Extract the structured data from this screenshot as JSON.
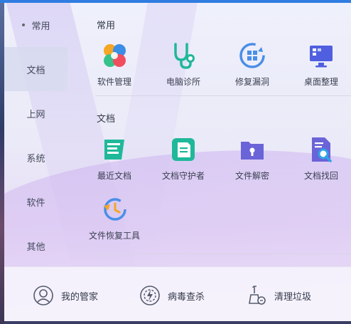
{
  "sidebar": {
    "items": [
      {
        "label": "常用",
        "active": false,
        "dot": true
      },
      {
        "label": "文档",
        "active": true,
        "dot": false
      },
      {
        "label": "上网",
        "active": false,
        "dot": false
      },
      {
        "label": "系统",
        "active": false,
        "dot": false
      },
      {
        "label": "软件",
        "active": false,
        "dot": false
      },
      {
        "label": "其他",
        "active": false,
        "dot": false
      }
    ]
  },
  "sections": [
    {
      "title": "常用",
      "tools": [
        {
          "label": "软件管理",
          "icon": "software-manager-icon"
        },
        {
          "label": "电脑诊所",
          "icon": "stethoscope-icon"
        },
        {
          "label": "修复漏洞",
          "icon": "windows-repair-icon"
        },
        {
          "label": "桌面整理",
          "icon": "desktop-organize-icon"
        }
      ]
    },
    {
      "title": "文档",
      "tools": [
        {
          "label": "最近文档",
          "icon": "recent-docs-icon"
        },
        {
          "label": "文档守护者",
          "icon": "doc-guardian-icon"
        },
        {
          "label": "文件解密",
          "icon": "folder-lock-icon"
        },
        {
          "label": "文档找回",
          "icon": "doc-search-icon"
        },
        {
          "label": "文件恢复工具",
          "icon": "file-recovery-icon"
        }
      ]
    }
  ],
  "bottom_bar": {
    "items": [
      {
        "label": "我的管家",
        "icon": "butler-avatar-icon"
      },
      {
        "label": "病毒查杀",
        "icon": "virus-scan-icon"
      },
      {
        "label": "清理垃圾",
        "icon": "cleanup-icon"
      }
    ]
  },
  "colors": {
    "accent_blue": "#2f7de0",
    "doc_icon_teal": "#1fb89a",
    "folder_purple": "#6b63d8",
    "recovery_blue": "#4a8ee8"
  }
}
